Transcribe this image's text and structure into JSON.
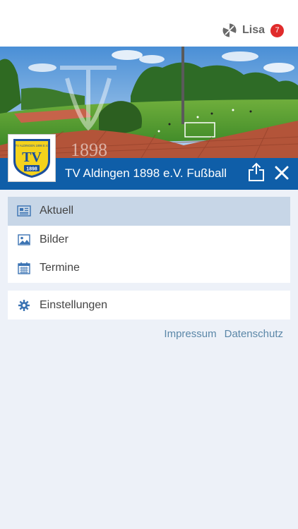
{
  "topbar": {
    "user_name": "Lisa",
    "notification_count": "7"
  },
  "header": {
    "title": "TV Aldingen 1898 e.V. Fußball"
  },
  "hero": {
    "watermark_year": "1898"
  },
  "crest": {
    "ring_text": "TV ALDINGEN 1898 E.V.",
    "letters": "TV",
    "year": "1898"
  },
  "menu": {
    "items": [
      {
        "label": "Aktuell",
        "icon": "newspaper-icon",
        "active": true
      },
      {
        "label": "Bilder",
        "icon": "image-icon",
        "active": false
      },
      {
        "label": "Termine",
        "icon": "calendar-icon",
        "active": false
      }
    ]
  },
  "settings": {
    "label": "Einstellungen",
    "icon": "gear-icon"
  },
  "footer_links": {
    "impressum": "Impressum",
    "datenschutz": "Datenschutz"
  },
  "colors": {
    "header_blue": "#0f5ea8",
    "active_item": "#c7d6e7",
    "badge_red": "#e02b2b",
    "link_color": "#5b87a8",
    "background": "#edf1f8"
  }
}
